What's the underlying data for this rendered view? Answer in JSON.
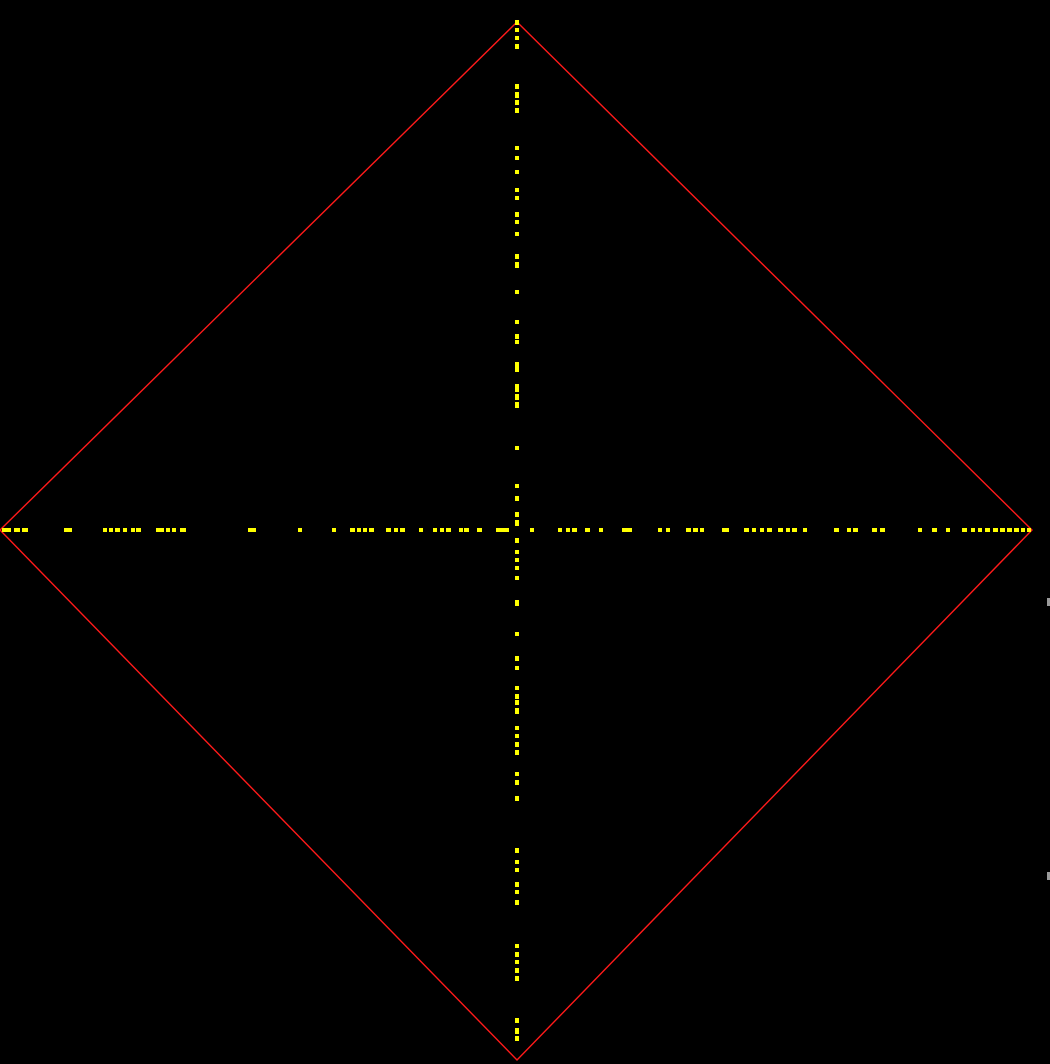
{
  "canvas": {
    "background": "#000000"
  },
  "diamond": {
    "stroke_color": "#ff1a1a"
  },
  "axes": {
    "dot_color": "#ffff00",
    "horizontal_dot_count": 72,
    "vertical_dot_count": 66
  }
}
